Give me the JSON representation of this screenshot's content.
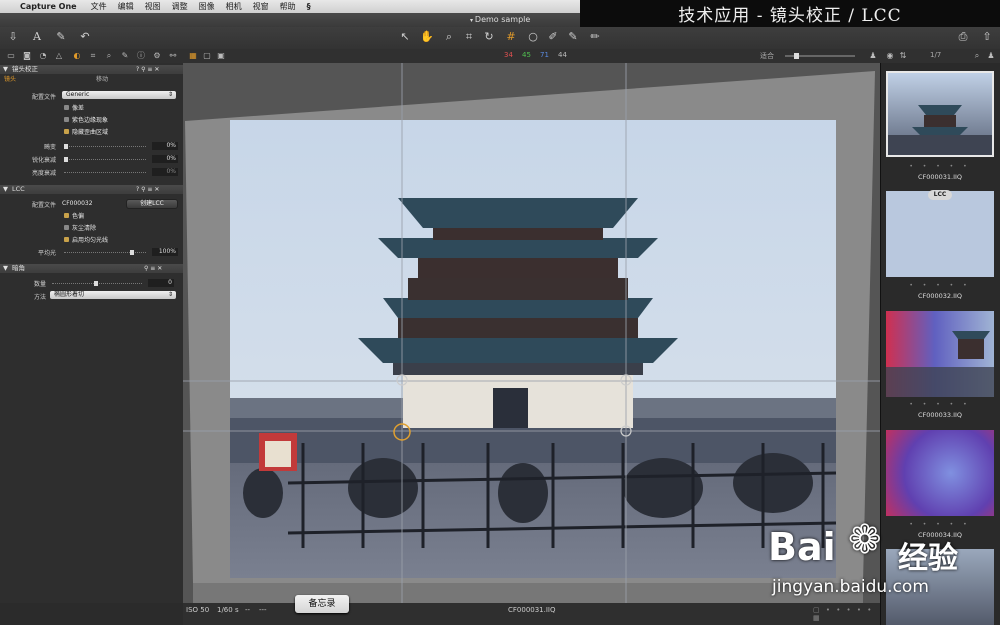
{
  "menubar": {
    "app_name": "Capture One",
    "items": [
      "文件",
      "编辑",
      "视图",
      "调整",
      "图像",
      "相机",
      "视窗",
      "帮助"
    ]
  },
  "banner": {
    "text": "技术应用 - 镜头校正 / LCC"
  },
  "window": {
    "title": "Demo sample"
  },
  "toolbar": {
    "counts": {
      "a": "34",
      "b": "45",
      "c": "71",
      "d": "44"
    },
    "zoom_label": "适合",
    "page_counter": "1/7"
  },
  "left_panel": {
    "lens": {
      "title": "镜头校正",
      "tab_active": "镜头",
      "tab_other": "移动",
      "profile_label": "配置文件",
      "profile_value": "Generic",
      "checks": [
        {
          "label": "像差",
          "checked": false
        },
        {
          "label": "紫色边缘现象",
          "checked": false
        },
        {
          "label": "隐藏歪曲区域",
          "checked": true
        }
      ],
      "sliders": [
        {
          "label": "畸变",
          "value": "0%"
        },
        {
          "label": "锐化衰减",
          "value": "0%"
        },
        {
          "label": "亮度衰减",
          "value": "0%"
        }
      ]
    },
    "lcc": {
      "title": "LCC",
      "profile_label": "配置文件",
      "profile_value": "CF000032",
      "create_button": "创建LCC",
      "checks": [
        {
          "label": "色偏",
          "checked": true
        },
        {
          "label": "灰尘清除",
          "checked": false
        },
        {
          "label": "启用均匀光线",
          "checked": true
        }
      ],
      "uniform_label": "平均光",
      "uniform_value": "100%"
    },
    "vignette": {
      "title": "暗角",
      "amount_label": "数量",
      "amount_value": "0",
      "method_label": "方法",
      "method_value": "椭圆形着切"
    }
  },
  "statusbar": {
    "iso": "ISO 50",
    "shutter": "1/60 s",
    "a": "--",
    "b": "---",
    "filename": "CF000031.IIQ"
  },
  "tooltip": {
    "text": "备忘录"
  },
  "browser": {
    "lcc_badge": "LCC",
    "thumbs": [
      {
        "name": "CF000031.IIQ"
      },
      {
        "name": "CF000032.IIQ"
      },
      {
        "name": "CF000033.IIQ"
      },
      {
        "name": "CF000034.IIQ"
      }
    ]
  },
  "watermark": {
    "brand": "Bai",
    "brand2": "经验",
    "url": "jingyan.baidu.com"
  }
}
